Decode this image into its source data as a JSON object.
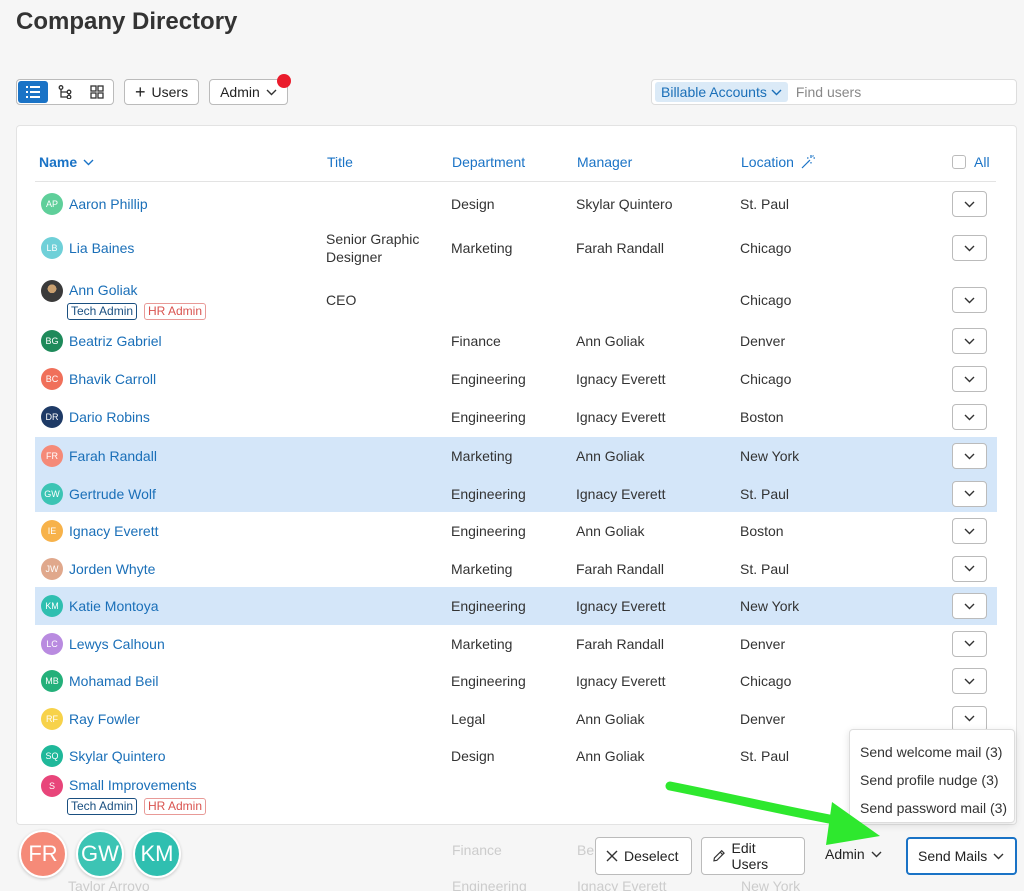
{
  "page_title": "Company Directory",
  "toolbar": {
    "add_users_label": "Users",
    "admin_label": "Admin"
  },
  "search": {
    "filter_chip": "Billable Accounts",
    "placeholder": "Find users"
  },
  "table": {
    "headers": {
      "name": "Name",
      "title": "Title",
      "department": "Department",
      "manager": "Manager",
      "location": "Location",
      "all": "All"
    },
    "rows": [
      {
        "initials": "AP",
        "color": "#5fcf9a",
        "name": "Aaron Phillip",
        "title": "",
        "department": "Design",
        "manager": "Skylar Quintero",
        "location": "St. Paul",
        "selected": false
      },
      {
        "initials": "LB",
        "color": "#6fd0d8",
        "name": "Lia Baines",
        "title": "Senior Graphic Designer",
        "department": "Marketing",
        "manager": "Farah Randall",
        "location": "Chicago",
        "selected": false
      },
      {
        "initials": "",
        "color": "#3a3a3a",
        "name": "Ann Goliak",
        "title": "CEO",
        "department": "",
        "manager": "",
        "location": "Chicago",
        "selected": false,
        "badges": [
          "Tech Admin",
          "HR Admin"
        ]
      },
      {
        "initials": "BG",
        "color": "#1e8a5a",
        "name": "Beatriz Gabriel",
        "title": "",
        "department": "Finance",
        "manager": "Ann Goliak",
        "location": "Denver",
        "selected": false
      },
      {
        "initials": "BC",
        "color": "#f0705a",
        "name": "Bhavik Carroll",
        "title": "",
        "department": "Engineering",
        "manager": "Ignacy Everett",
        "location": "Chicago",
        "selected": false
      },
      {
        "initials": "DR",
        "color": "#1e3a66",
        "name": "Dario Robins",
        "title": "",
        "department": "Engineering",
        "manager": "Ignacy Everett",
        "location": "Boston",
        "selected": false
      },
      {
        "initials": "FR",
        "color": "#f58a78",
        "name": "Farah Randall",
        "title": "",
        "department": "Marketing",
        "manager": "Ann Goliak",
        "location": "New York",
        "selected": true
      },
      {
        "initials": "GW",
        "color": "#3cc4b4",
        "name": "Gertrude Wolf",
        "title": "",
        "department": "Engineering",
        "manager": "Ignacy Everett",
        "location": "St. Paul",
        "selected": true
      },
      {
        "initials": "IE",
        "color": "#f7b24a",
        "name": "Ignacy Everett",
        "title": "",
        "department": "Engineering",
        "manager": "Ann Goliak",
        "location": "Boston",
        "selected": false
      },
      {
        "initials": "JW",
        "color": "#e0a88c",
        "name": "Jorden Whyte",
        "title": "",
        "department": "Marketing",
        "manager": "Farah Randall",
        "location": "St. Paul",
        "selected": false
      },
      {
        "initials": "KM",
        "color": "#2fbfb0",
        "name": "Katie Montoya",
        "title": "",
        "department": "Engineering",
        "manager": "Ignacy Everett",
        "location": "New York",
        "selected": true
      },
      {
        "initials": "LC",
        "color": "#b98be0",
        "name": "Lewys Calhoun",
        "title": "",
        "department": "Marketing",
        "manager": "Farah Randall",
        "location": "Denver",
        "selected": false
      },
      {
        "initials": "MB",
        "color": "#24b07a",
        "name": "Mohamad Beil",
        "title": "",
        "department": "Engineering",
        "manager": "Ignacy Everett",
        "location": "Chicago",
        "selected": false
      },
      {
        "initials": "RF",
        "color": "#f7d24a",
        "name": "Ray Fowler",
        "title": "",
        "department": "Legal",
        "manager": "Ann Goliak",
        "location": "Denver",
        "selected": false
      },
      {
        "initials": "SQ",
        "color": "#1fb89a",
        "name": "Skylar Quintero",
        "title": "",
        "department": "Design",
        "manager": "Ann Goliak",
        "location": "St. Paul",
        "selected": false
      },
      {
        "initials": "S",
        "color": "#e8457a",
        "name": "Small Improvements",
        "title": "",
        "department": "",
        "manager": "",
        "location": "",
        "selected": false,
        "badges": [
          "Tech Admin",
          "HR Admin"
        ]
      }
    ]
  },
  "ghost_rows": {
    "row1_department": "Finance",
    "row1_manager": "Be",
    "row2_name": "Taylor Arroyo",
    "row2_department": "Engineering",
    "row2_manager": "Ignacy Everett",
    "row2_location": "New York"
  },
  "selected_avatars": [
    {
      "initials": "FR",
      "color": "#f58a78"
    },
    {
      "initials": "GW",
      "color": "#3cc4b4"
    },
    {
      "initials": "KM",
      "color": "#2fbfb0"
    }
  ],
  "bottom": {
    "deselect_label": "Deselect",
    "edit_users_label": "Edit Users",
    "admin_label": "Admin",
    "send_mails_label": "Send Mails"
  },
  "send_mails_menu": [
    "Send welcome mail (3)",
    "Send profile nudge (3)",
    "Send password mail (3)"
  ],
  "colors": {
    "accent": "#1a73c6",
    "selected_row": "#d4e6f9",
    "notification_dot": "#ea1c2c",
    "annotation_arrow": "#2ee82e"
  }
}
